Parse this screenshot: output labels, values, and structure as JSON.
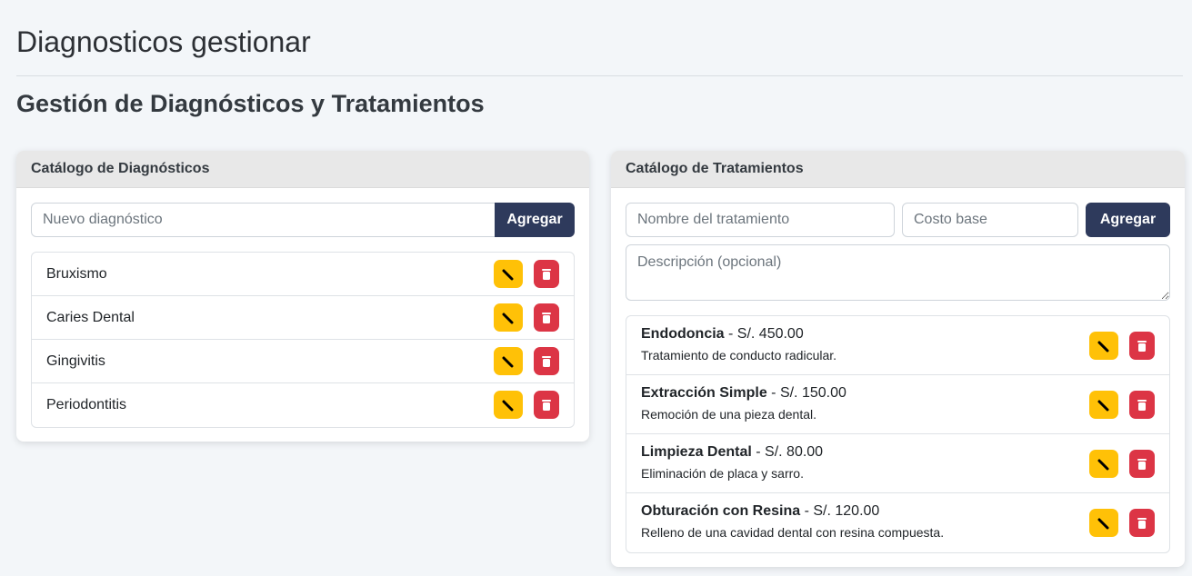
{
  "page": {
    "title": "Diagnosticos gestionar",
    "section_title": "Gestión de Diagnósticos y Tratamientos"
  },
  "diagnosticos": {
    "header": "Catálogo de Diagnósticos",
    "input_placeholder": "Nuevo diagnóstico",
    "add_label": "Agregar",
    "items": [
      {
        "name": "Bruxismo"
      },
      {
        "name": "Caries Dental"
      },
      {
        "name": "Gingivitis"
      },
      {
        "name": "Periodontitis"
      }
    ]
  },
  "tratamientos": {
    "header": "Catálogo de Tratamientos",
    "name_placeholder": "Nombre del tratamiento",
    "cost_placeholder": "Costo base",
    "desc_placeholder": "Descripción (opcional)",
    "add_label": "Agregar",
    "separator": " - ",
    "items": [
      {
        "name": "Endodoncia",
        "cost": "S/. 450.00",
        "desc": "Tratamiento de conducto radicular."
      },
      {
        "name": "Extracción Simple",
        "cost": "S/. 150.00",
        "desc": "Remoción de una pieza dental."
      },
      {
        "name": "Limpieza Dental",
        "cost": "S/. 80.00",
        "desc": "Eliminación de placa y sarro."
      },
      {
        "name": "Obturación con Resina",
        "cost": "S/. 120.00",
        "desc": "Relleno de una cavidad dental con resina compuesta."
      }
    ]
  },
  "colors": {
    "primary": "#2e3a5c",
    "edit": "#ffc107",
    "delete": "#dc3545"
  },
  "icons": {
    "edit": "pencil-icon",
    "delete": "trash-icon"
  }
}
